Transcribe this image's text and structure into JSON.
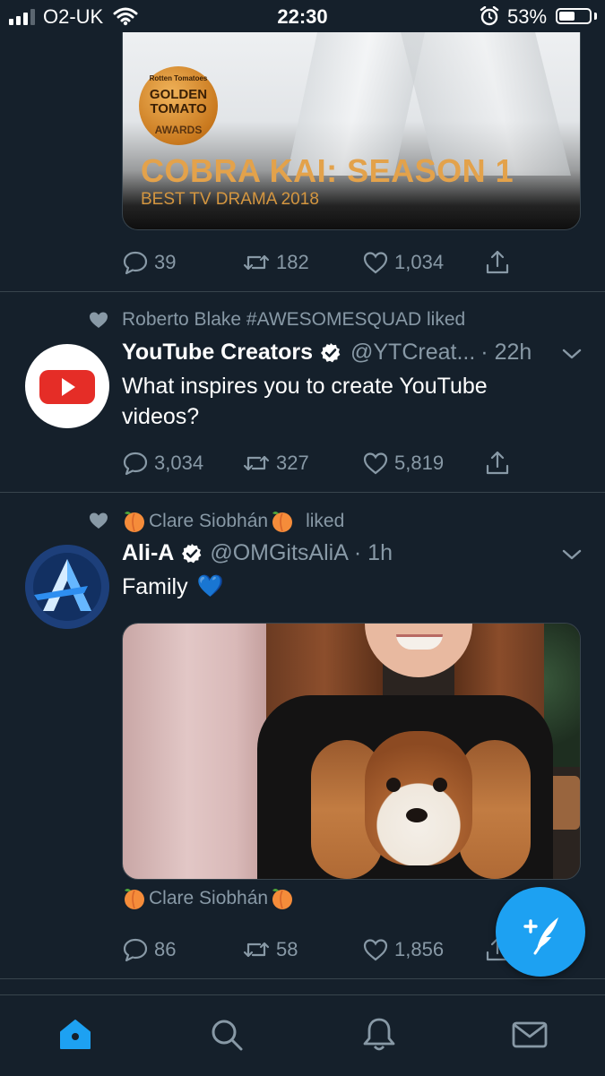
{
  "status_bar": {
    "carrier": "O2-UK",
    "time": "22:30",
    "battery_percent": "53%",
    "battery_level": 0.53
  },
  "cobra_card": {
    "badge_small": "Rotten Tomatoes",
    "badge_title_1": "GOLDEN",
    "badge_title_2": "TOMATO",
    "badge_awards": "AWARDS",
    "title": "COBRA KAI: SEASON 1",
    "subtitle": "BEST TV DRAMA 2018"
  },
  "tweets": [
    {
      "actions": {
        "replies": "39",
        "retweets": "182",
        "likes": "1,034"
      }
    },
    {
      "social_context": "Roberto Blake #AWESOMESQUAD liked",
      "name": "YouTube Creators",
      "handle": "@YTCreat...",
      "time": "· 22h",
      "text_line1": "What inspires you to create YouTube",
      "text_line2": "videos?",
      "actions": {
        "replies": "3,034",
        "retweets": "327",
        "likes": "5,819"
      }
    },
    {
      "social_context_name": "Clare Siobhán",
      "social_context_verb": "liked",
      "name": "Ali-A",
      "handle": "@OMGitsAliA",
      "time": "· 1h",
      "text": "Family",
      "text_emoji": "💙",
      "tagged": "Clare Siobhán",
      "actions": {
        "replies": "86",
        "retweets": "58",
        "likes": "1,856"
      }
    }
  ],
  "colors": {
    "background": "#15202b",
    "secondary_text": "#8899a6",
    "accent": "#1da1f2",
    "divider": "#38444d"
  },
  "tabbar": {
    "icons": [
      "home-icon",
      "search-icon",
      "notifications-icon",
      "messages-icon"
    ],
    "active": "home-icon"
  }
}
